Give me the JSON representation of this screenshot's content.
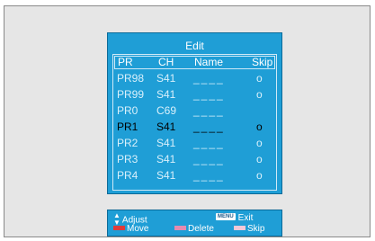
{
  "menu": {
    "title": "Edit",
    "columns": {
      "pr": "PR",
      "ch": "CH",
      "name": "Name",
      "skip": "Skip"
    },
    "rows": [
      {
        "pr": "PR98",
        "ch": "S41",
        "name": "____",
        "skip": "o",
        "selected": false
      },
      {
        "pr": "PR99",
        "ch": "S41",
        "name": "____",
        "skip": "o",
        "selected": false
      },
      {
        "pr": "PR0",
        "ch": "C69",
        "name": "____",
        "skip": "",
        "selected": false
      },
      {
        "pr": "PR1",
        "ch": "S41",
        "name": "____",
        "skip": "o",
        "selected": true
      },
      {
        "pr": "PR2",
        "ch": "S41",
        "name": "____",
        "skip": "o",
        "selected": false
      },
      {
        "pr": "PR3",
        "ch": "S41",
        "name": "____",
        "skip": "o",
        "selected": false
      },
      {
        "pr": "PR4",
        "ch": "S41",
        "name": "____",
        "skip": "o",
        "selected": false
      }
    ]
  },
  "help": {
    "adjust_label": "Adjust",
    "menu_key": "MENU",
    "exit_label": "Exit",
    "move_label": "Move",
    "delete_label": "Delete",
    "skip_label": "Skip",
    "icons": {
      "adjust": "up-down-arrow-icon",
      "move": "red-key-icon",
      "delete": "pink-key-icon",
      "skip": "light-pink-key-icon"
    }
  },
  "colors": {
    "panel": "#1f9ed6",
    "background": "#e6e6e6",
    "move_key": "#e03a3a",
    "delete_key": "#e58ab0",
    "skip_key": "#f2c8d8"
  }
}
